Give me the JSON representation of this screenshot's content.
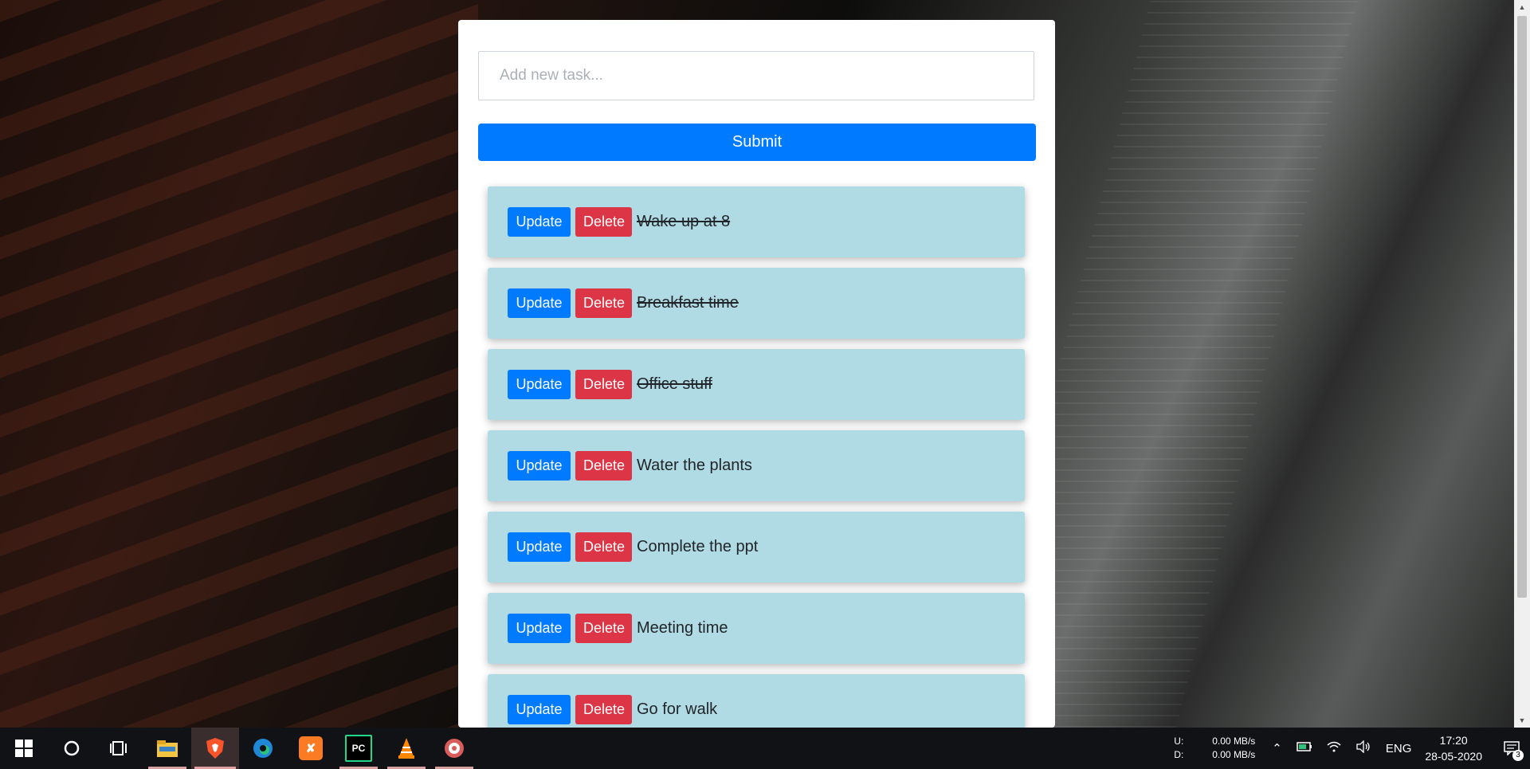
{
  "form": {
    "placeholder": "Add new task...",
    "submit_label": "Submit"
  },
  "tasks": [
    {
      "update_label": "Update",
      "delete_label": "Delete",
      "text": "Wake up at 8",
      "completed": true
    },
    {
      "update_label": "Update",
      "delete_label": "Delete",
      "text": "Breakfast time",
      "completed": true
    },
    {
      "update_label": "Update",
      "delete_label": "Delete",
      "text": "Office stuff",
      "completed": true
    },
    {
      "update_label": "Update",
      "delete_label": "Delete",
      "text": "Water the plants",
      "completed": false
    },
    {
      "update_label": "Update",
      "delete_label": "Delete",
      "text": "Complete the ppt",
      "completed": false
    },
    {
      "update_label": "Update",
      "delete_label": "Delete",
      "text": "Meeting time",
      "completed": false
    },
    {
      "update_label": "Update",
      "delete_label": "Delete",
      "text": "Go for walk",
      "completed": false
    }
  ],
  "colors": {
    "primary": "#007bff",
    "danger": "#dc3545",
    "task_bg": "#b0dae4"
  },
  "taskbar": {
    "apps": [
      "windows-start-icon",
      "search-icon",
      "task-view-icon",
      "file-explorer-icon",
      "brave-browser-icon",
      "edge-browser-icon",
      "xampp-icon",
      "pycharm-icon",
      "vlc-icon",
      "music-player-icon"
    ],
    "upload_label": "U:",
    "download_label": "D:",
    "upload_speed": "0.00 MB/s",
    "download_speed": "0.00 MB/s",
    "language": "ENG",
    "time": "17:20",
    "date": "28-05-2020",
    "notification_count": "3"
  }
}
